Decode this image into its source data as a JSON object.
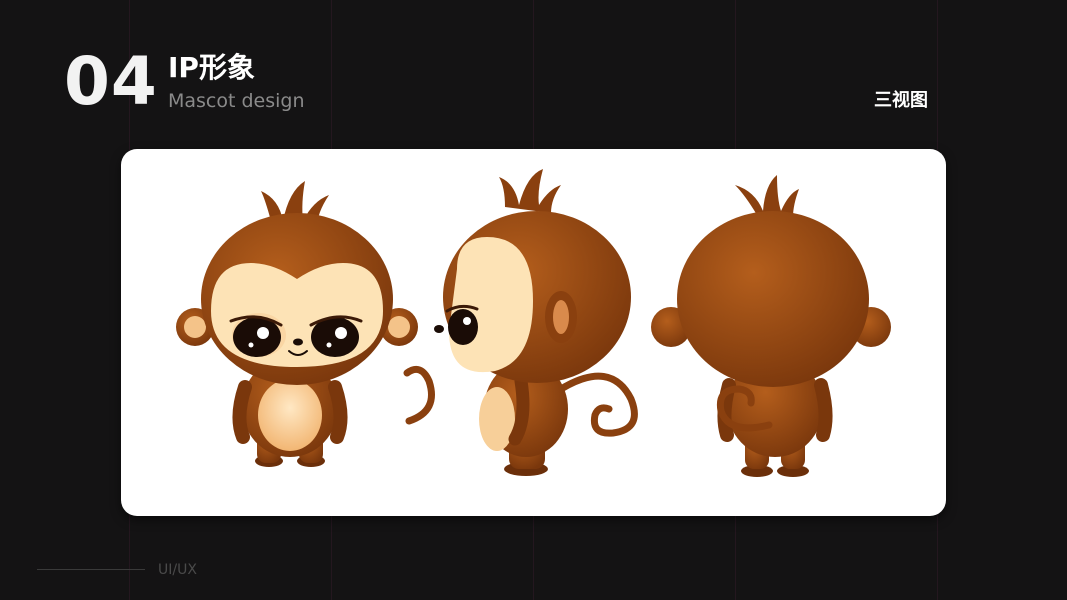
{
  "header": {
    "section_number": "04",
    "title_zh": "IP形象",
    "title_en": "Mascot  design",
    "view_label": "三视图"
  },
  "footer": {
    "label": "UI/UX"
  },
  "mascot": {
    "views": [
      "front",
      "side",
      "back"
    ],
    "colors": {
      "fur": "#9a4a14",
      "fur_dark": "#6b2f0a",
      "face": "#fde3b6",
      "belly": "#fbd8a2",
      "eye": "#1a0c06",
      "background": "#141314",
      "card": "#ffffff"
    }
  }
}
